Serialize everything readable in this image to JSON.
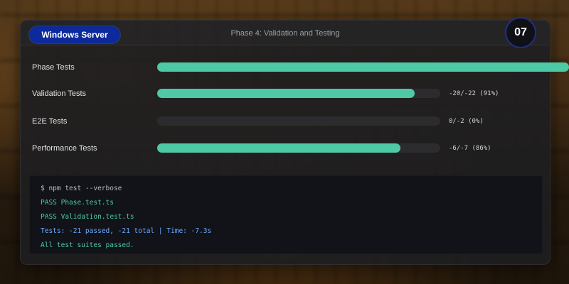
{
  "header": {
    "os_badge": "Windows Server",
    "phase_title": "Phase 4: Validation and Testing",
    "step_number": "07"
  },
  "tests": [
    {
      "label": "Phase Tests",
      "value_text": "",
      "percent": 100
    },
    {
      "label": "Validation Tests",
      "value_text": "-20/-22 (91%)",
      "percent": 91
    },
    {
      "label": "E2E Tests",
      "value_text": "0/-2 (0%)",
      "percent": 0
    },
    {
      "label": "Performance Tests",
      "value_text": "-6/-7 (86%)",
      "percent": 86
    }
  ],
  "terminal": {
    "lines": [
      {
        "text": "$ npm test --verbose",
        "color": "#b8bcc2"
      },
      {
        "text": "PASS Phase.test.ts",
        "color": "#4ec9a6"
      },
      {
        "text": "PASS Validation.test.ts",
        "color": "#4ec9a6"
      },
      {
        "text": "Tests: -21 passed, -21 total | Time: -7.3s",
        "color": "#6aa9ff"
      },
      {
        "text": "All test suites passed.",
        "color": "#4ec9a6"
      }
    ]
  },
  "colors": {
    "accent": "#4ec9a6",
    "badge": "#0c2a9c",
    "track": "#2c2c2e"
  }
}
